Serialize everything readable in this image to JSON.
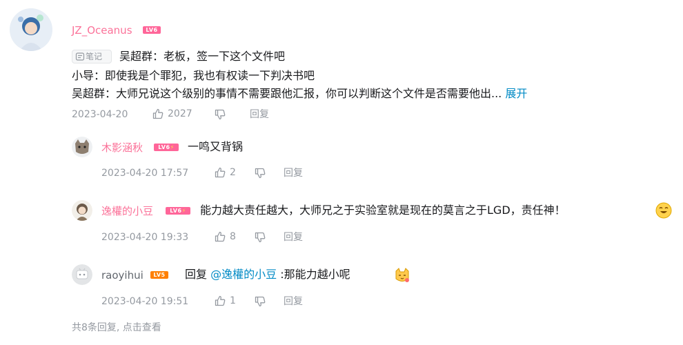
{
  "main_comment": {
    "username": "JZ_Oceanus",
    "level": "LV6",
    "note_tag": "笔记",
    "lines": [
      "吴超群：老板，签一下这个文件吧",
      "小导：即使我是个罪犯，我也有权读一下判决书吧",
      "吴超群：大师兄说这个级别的事情不需要跟他汇报，你可以判断这个文件是否需要他出..."
    ],
    "expand_label": "展开",
    "date": "2023-04-20",
    "likes": "2027",
    "reply_label": "回复"
  },
  "replies": [
    {
      "username": "木影涵秋",
      "level": "LV6",
      "text": "一鸣又背锅",
      "date": "2023-04-20 17:57",
      "likes": "2",
      "reply_label": "回复"
    },
    {
      "username": "逸權的小豆",
      "level": "LV6",
      "text": "能力越大责任越大，大师兄之于实验室就是现在的莫言之于LGD，责任神！",
      "date": "2023-04-20 19:33",
      "likes": "8",
      "reply_label": "回复"
    },
    {
      "username": "raoyihui",
      "level": "LV5",
      "reply_prefix": "回复",
      "mention": "@逸權的小豆",
      "text": ":那能力越小呢",
      "date": "2023-04-20 19:51",
      "likes": "1",
      "reply_label": "回复"
    }
  ],
  "footer": {
    "more_replies": "共8条回复, 点击查看"
  },
  "colors": {
    "vip_name": "#fb7299",
    "normal_name": "#61666d",
    "link": "#008ac5",
    "meta": "#9499a0"
  },
  "icons": [
    "avatar-icon",
    "note-icon",
    "thumb-up-icon",
    "thumb-down-icon",
    "smile-emoji-icon",
    "cat-emoji-icon"
  ]
}
